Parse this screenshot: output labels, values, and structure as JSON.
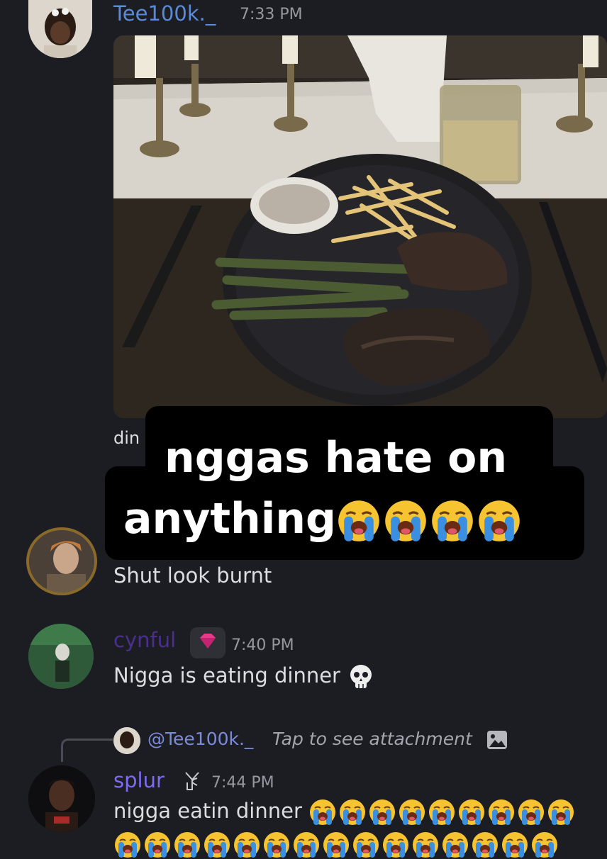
{
  "messages": [
    {
      "author": "Tee100k._",
      "time": "7:33 PM",
      "text_partial": "din",
      "name_color": "#5b8bd8"
    },
    {
      "author": "",
      "time": "",
      "text": "Shut look burnt"
    },
    {
      "author": "cynful",
      "time": "7:40 PM",
      "text": "Nigga is eating dinner",
      "name_color": "#4a2f8f",
      "badge": "gem-icon",
      "emoji": "skull"
    },
    {
      "author": "splur",
      "time": "7:44 PM",
      "text": "nigga eatin dinner",
      "name_color": "#7b6cf0",
      "badge": "ysl-logo",
      "emoji": "loudly-crying",
      "emoji_count_line1": 9
    }
  ],
  "reply": {
    "mention": "@Tee100k._",
    "preview": "Tap to see attachment",
    "icon": "image-icon"
  },
  "caption": {
    "line1": "nggas hate on",
    "line2": "anything",
    "emoji": "loudly-crying",
    "emoji_count": 4
  },
  "colors": {
    "background": "#1c1d22",
    "text": "#dcdde1",
    "muted": "#96989f",
    "caption_bg": "#000000"
  }
}
